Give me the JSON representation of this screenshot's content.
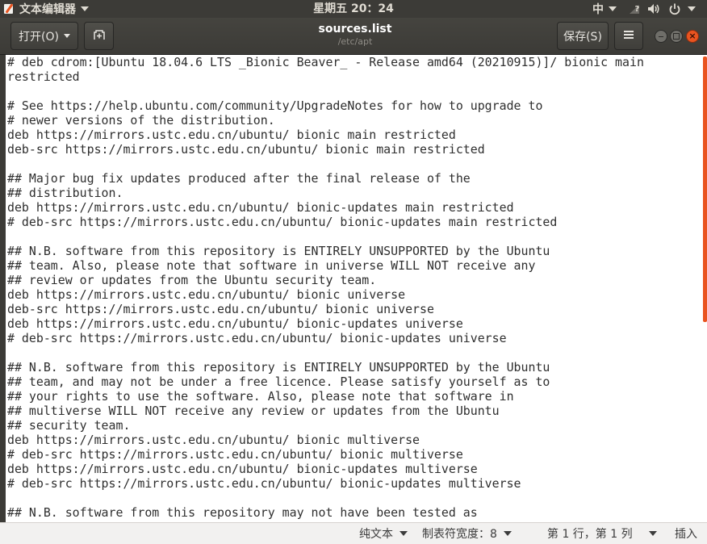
{
  "top_panel": {
    "app_name": "文本编辑器",
    "clock": "星期五 20：24",
    "input_method": "中"
  },
  "headerbar": {
    "open_label": "打开(O)",
    "title": "sources.list",
    "path": "/etc/apt",
    "save_label": "保存(S)"
  },
  "editor": {
    "lines": [
      "# deb cdrom:[Ubuntu 18.04.6 LTS _Bionic Beaver_ - Release amd64 (20210915)]/ bionic main",
      "restricted",
      "",
      "# See https://help.ubuntu.com/community/UpgradeNotes for how to upgrade to",
      "# newer versions of the distribution.",
      "deb https://mirrors.ustc.edu.cn/ubuntu/ bionic main restricted",
      "deb-src https://mirrors.ustc.edu.cn/ubuntu/ bionic main restricted",
      "",
      "## Major bug fix updates produced after the final release of the",
      "## distribution.",
      "deb https://mirrors.ustc.edu.cn/ubuntu/ bionic-updates main restricted",
      "# deb-src https://mirrors.ustc.edu.cn/ubuntu/ bionic-updates main restricted",
      "",
      "## N.B. software from this repository is ENTIRELY UNSUPPORTED by the Ubuntu",
      "## team. Also, please note that software in universe WILL NOT receive any",
      "## review or updates from the Ubuntu security team.",
      "deb https://mirrors.ustc.edu.cn/ubuntu/ bionic universe",
      "deb-src https://mirrors.ustc.edu.cn/ubuntu/ bionic universe",
      "deb https://mirrors.ustc.edu.cn/ubuntu/ bionic-updates universe",
      "# deb-src https://mirrors.ustc.edu.cn/ubuntu/ bionic-updates universe",
      "",
      "## N.B. software from this repository is ENTIRELY UNSUPPORTED by the Ubuntu",
      "## team, and may not be under a free licence. Please satisfy yourself as to",
      "## your rights to use the software. Also, please note that software in",
      "## multiverse WILL NOT receive any review or updates from the Ubuntu",
      "## security team.",
      "deb https://mirrors.ustc.edu.cn/ubuntu/ bionic multiverse",
      "# deb-src https://mirrors.ustc.edu.cn/ubuntu/ bionic multiverse",
      "deb https://mirrors.ustc.edu.cn/ubuntu/ bionic-updates multiverse",
      "# deb-src https://mirrors.ustc.edu.cn/ubuntu/ bionic-updates multiverse",
      "",
      "## N.B. software from this repository may not have been tested as"
    ]
  },
  "statusbar": {
    "syntax": "纯文本",
    "tab_width": "制表符宽度：8",
    "position": "第 1 行，第 1 列",
    "mode": "插入"
  },
  "colors": {
    "accent": "#e95420",
    "panel": "#3c3b37",
    "text": "#2e2e2e"
  }
}
